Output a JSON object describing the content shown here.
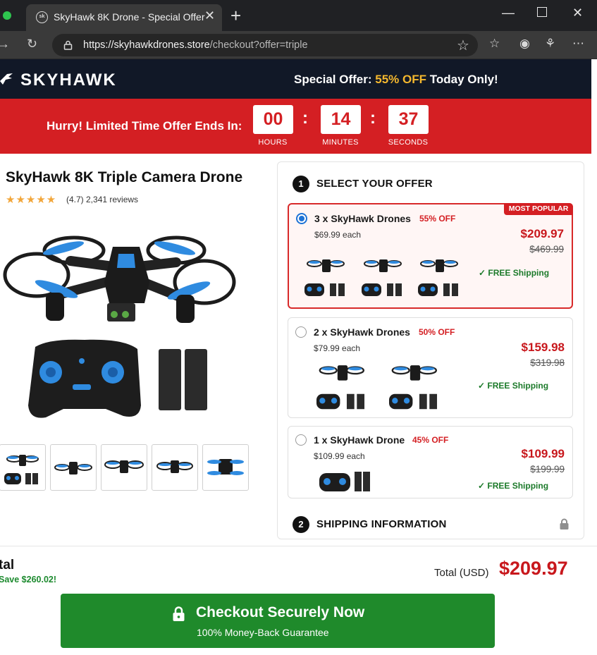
{
  "browser": {
    "tab_title": "SkyHawk 8K Drone - Special Offer",
    "favicon_text": "sk",
    "url_host": "https://skyhawkdrones.store",
    "url_path": "/checkout?offer=triple"
  },
  "header": {
    "brand": "SKYHAWK",
    "promo_prefix": "Special Offer: ",
    "promo_highlight": "55% OFF",
    "promo_suffix": " Today Only!"
  },
  "countdown": {
    "label": "Hurry! Limited Time Offer Ends In:",
    "hours": "00",
    "minutes": "14",
    "seconds": "37",
    "hours_label": "HOURS",
    "minutes_label": "MINUTES",
    "seconds_label": "SECONDS",
    "separator": ":"
  },
  "product": {
    "title": "SkyHawk 8K Triple Camera Drone",
    "rating_stars": "★★★★★",
    "rating": 4.7,
    "reviews_text": "(4.7) 2,341 reviews"
  },
  "offer_panel": {
    "step1_number": "1",
    "step1_title": "SELECT YOUR OFFER",
    "step2_number": "2",
    "step2_title": "SHIPPING INFORMATION",
    "offers": [
      {
        "name": "3 x SkyHawk Drones",
        "discount": "55% OFF",
        "each": "$69.99 each",
        "price": "$209.97",
        "old_price": "$469.99",
        "shipping": "✓ FREE Shipping",
        "badge": "MOST POPULAR",
        "selected": true
      },
      {
        "name": "2 x SkyHawk Drones",
        "discount": "50% OFF",
        "each": "$79.99 each",
        "price": "$159.98",
        "old_price": "$319.98",
        "shipping": "✓ FREE Shipping",
        "selected": false
      },
      {
        "name": "1 x SkyHawk Drone",
        "discount": "45% OFF",
        "each": "$109.99 each",
        "price": "$109.99",
        "old_price": "$199.99",
        "shipping": "✓ FREE Shipping",
        "selected": false
      }
    ]
  },
  "bottom": {
    "total_left": "tal",
    "save_text": "Save $260.02!",
    "total_label": "Total (USD)",
    "total_value": "$209.97",
    "checkout_title": "Checkout Securely Now",
    "checkout_sub": "100% Money-Back Guarantee"
  },
  "colors": {
    "brand_red": "#d41f23",
    "header_dark": "#111827",
    "checkout_green": "#1f8a2b",
    "promo_yellow": "#f5b82e",
    "drone_blue": "#2f8be0"
  }
}
